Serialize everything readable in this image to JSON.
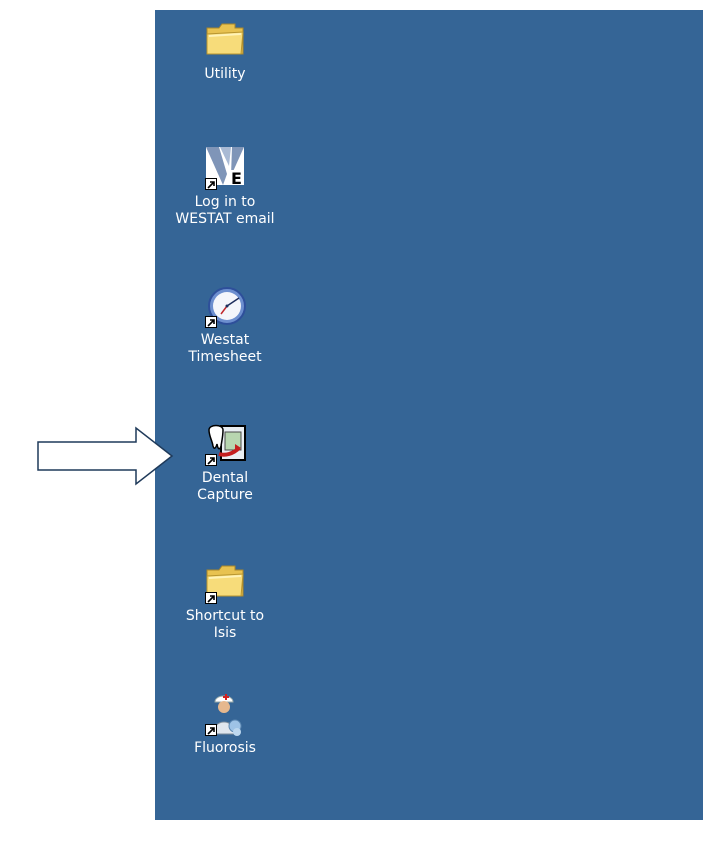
{
  "desktop": {
    "background_color": "#356596",
    "label_color": "#ffffff",
    "icons": [
      {
        "name": "utility-folder",
        "icon": "folder-icon",
        "label_lines": [
          "Utility"
        ],
        "shortcut": false
      },
      {
        "name": "westat-email",
        "icon": "westat-email-logo-icon",
        "label_lines": [
          "Log in to",
          "WESTAT email"
        ],
        "shortcut": true
      },
      {
        "name": "westat-timesheet",
        "icon": "clock-icon",
        "label_lines": [
          "Westat",
          "Timesheet"
        ],
        "shortcut": true
      },
      {
        "name": "dental-capture",
        "icon": "dental-capture-icon",
        "label_lines": [
          "Dental",
          "Capture"
        ],
        "shortcut": true
      },
      {
        "name": "isis-shortcut",
        "icon": "folder-icon",
        "label_lines": [
          "Shortcut to",
          "Isis"
        ],
        "shortcut": true
      },
      {
        "name": "fluorosis",
        "icon": "nurse-icon",
        "label_lines": [
          "Fluorosis"
        ],
        "shortcut": true
      }
    ]
  },
  "annotation": {
    "icon": "right-arrow-icon",
    "points_to": "dental-capture"
  }
}
